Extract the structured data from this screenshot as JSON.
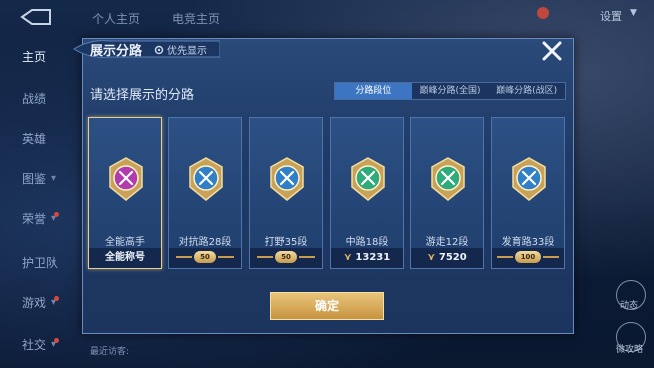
{
  "nav": {
    "items": [
      {
        "label": "主页",
        "active": true,
        "chevron": false,
        "dot": false
      },
      {
        "label": "战绩",
        "active": false,
        "chevron": false,
        "dot": false
      },
      {
        "label": "英雄",
        "active": false,
        "chevron": false,
        "dot": false
      },
      {
        "label": "图鉴",
        "active": false,
        "chevron": true,
        "dot": false
      },
      {
        "label": "荣誉",
        "active": false,
        "chevron": true,
        "dot": true
      },
      {
        "label": "护卫队",
        "active": false,
        "chevron": true,
        "dot": false
      },
      {
        "label": "游戏",
        "active": false,
        "chevron": true,
        "dot": true
      },
      {
        "label": "社交",
        "active": false,
        "chevron": true,
        "dot": true
      }
    ]
  },
  "top": {
    "tabs": [
      "个人主页",
      "电竞主页"
    ],
    "settings_label": "设置"
  },
  "modal": {
    "title": "展示分路",
    "priority_label": "优先显示",
    "prompt": "请选择展示的分路",
    "tabs": [
      "分路段位",
      "巅峰分路(全国)",
      "巅峰分路(战区)"
    ],
    "active_tab": 0,
    "confirm_label": "确定",
    "cards": [
      {
        "name": "全能高手",
        "footer": "全能称号",
        "footer_type": "text",
        "selected": true,
        "color": "#b23bb0",
        "icon": "all-round-icon"
      },
      {
        "name": "对抗路28段",
        "footer": "50",
        "footer_type": "badge",
        "selected": false,
        "color": "#2f7fc9",
        "icon": "clash-lane-icon"
      },
      {
        "name": "打野35段",
        "footer": "50",
        "footer_type": "badge",
        "selected": false,
        "color": "#2f7fc9",
        "icon": "jungle-icon"
      },
      {
        "name": "中路18段",
        "footer": "13231",
        "footer_type": "score",
        "selected": false,
        "color": "#2faa7a",
        "icon": "mid-lane-icon"
      },
      {
        "name": "游走12段",
        "footer": "7520",
        "footer_type": "score",
        "selected": false,
        "color": "#2faa7a",
        "icon": "roam-icon"
      },
      {
        "name": "发育路33段",
        "footer": "100",
        "footer_type": "badge",
        "selected": false,
        "color": "#2f7fc9",
        "icon": "farm-lane-icon"
      }
    ]
  },
  "bottom": {
    "recent_label": "最近访客:",
    "right_buttons": [
      "动态",
      "微攻略"
    ]
  }
}
